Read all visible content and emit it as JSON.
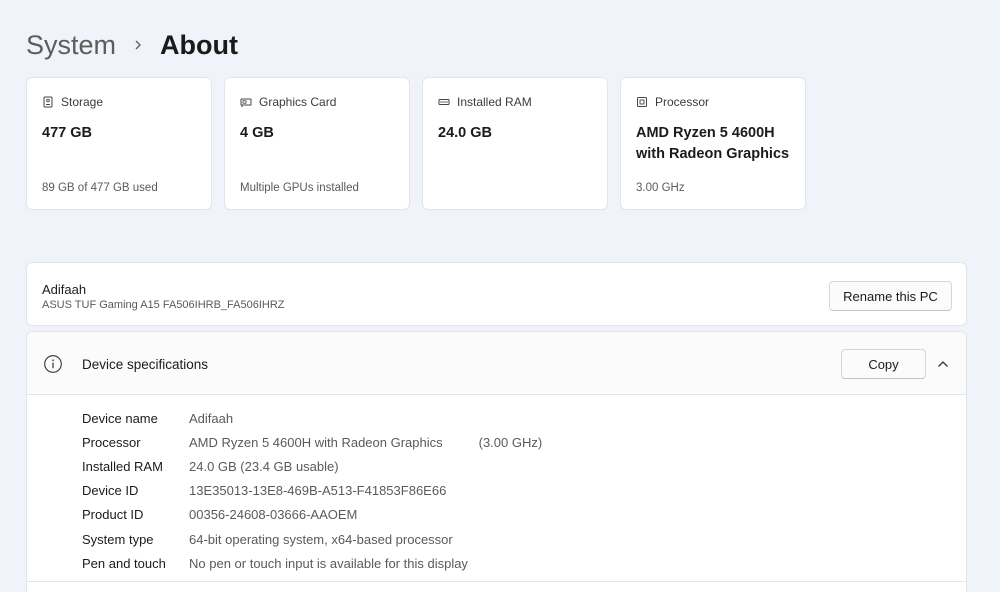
{
  "breadcrumb": {
    "parent": "System",
    "current": "About"
  },
  "cards": [
    {
      "icon": "storage-icon",
      "label": "Storage",
      "value": "477 GB",
      "sub": "89 GB of 477 GB used"
    },
    {
      "icon": "graphics-card-icon",
      "label": "Graphics Card",
      "value": "4 GB",
      "sub": "Multiple GPUs installed"
    },
    {
      "icon": "ram-icon",
      "label": "Installed RAM",
      "value": "24.0 GB",
      "sub": ""
    },
    {
      "icon": "processor-icon",
      "label": "Processor",
      "value": "AMD Ryzen 5 4600H with Radeon Graphics",
      "sub": "3.00 GHz"
    }
  ],
  "pc": {
    "name": "Adifaah",
    "model": "ASUS TUF Gaming A15 FA506IHRB_FA506IHRZ",
    "rename_label": "Rename this PC"
  },
  "specs": {
    "title": "Device specifications",
    "copy_label": "Copy",
    "rows": [
      {
        "label": "Device name",
        "value": "Adifaah",
        "extra": ""
      },
      {
        "label": "Processor",
        "value": "AMD Ryzen 5 4600H with Radeon Graphics",
        "extra": "(3.00 GHz)"
      },
      {
        "label": "Installed RAM",
        "value": "24.0 GB (23.4 GB usable)",
        "extra": ""
      },
      {
        "label": "Device ID",
        "value": "13E35013-13E8-469B-A513-F41853F86E66",
        "extra": ""
      },
      {
        "label": "Product ID",
        "value": "00356-24608-03666-AAOEM",
        "extra": ""
      },
      {
        "label": "System type",
        "value": "64-bit operating system, x64-based processor",
        "extra": ""
      },
      {
        "label": "Pen and touch",
        "value": "No pen or touch input is available for this display",
        "extra": ""
      }
    ]
  }
}
